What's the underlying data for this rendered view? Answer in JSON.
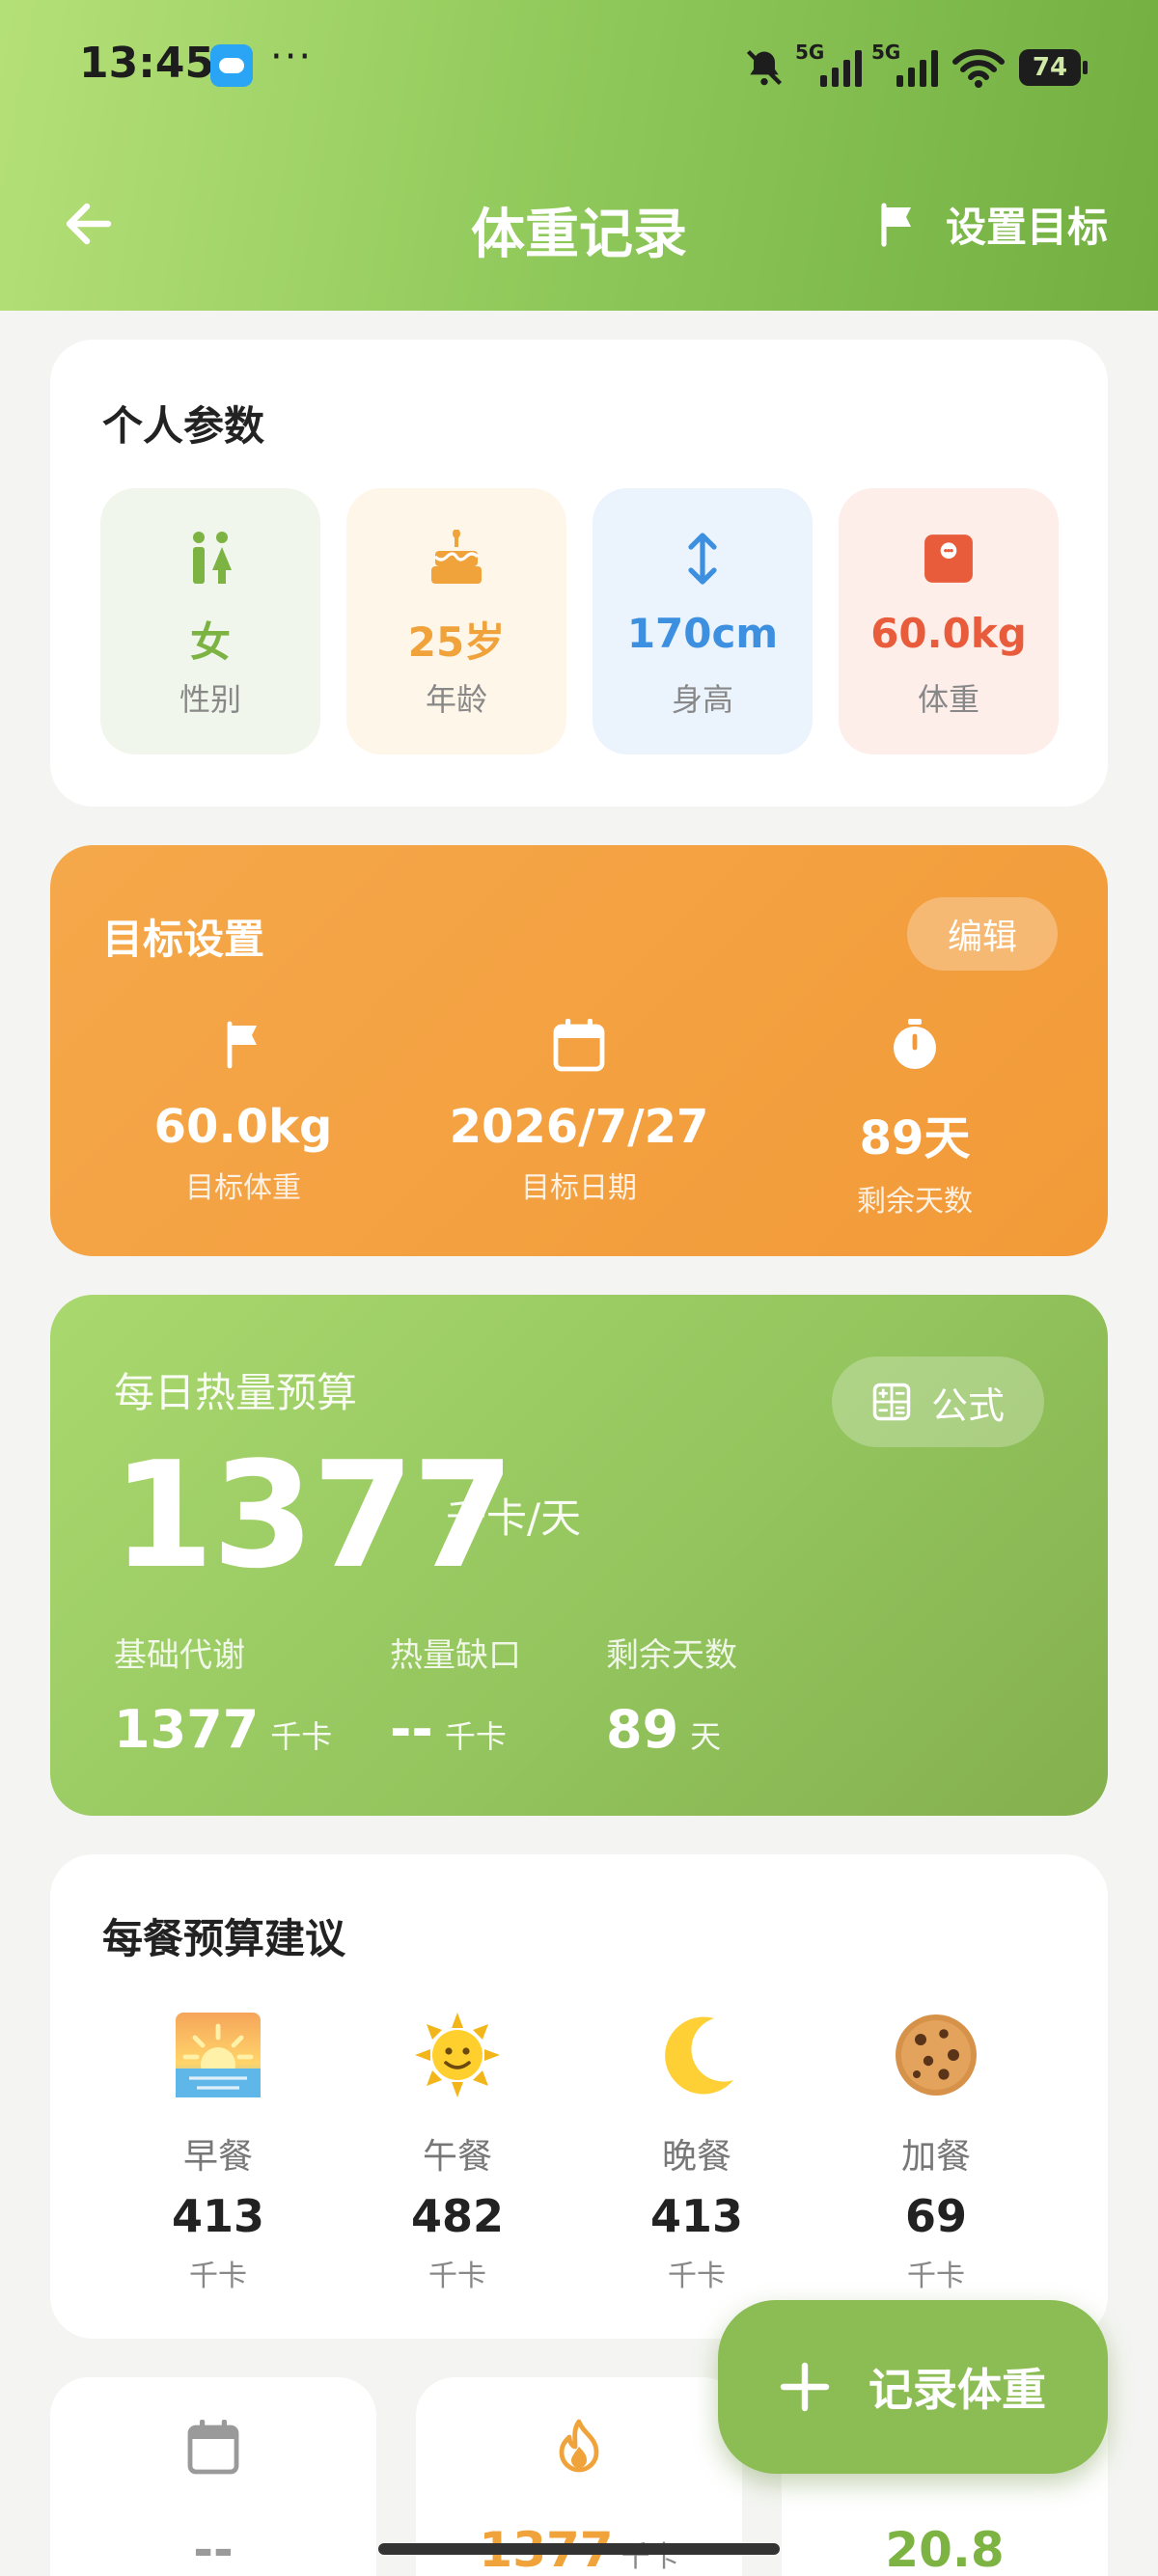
{
  "status": {
    "time": "13:45",
    "dots": "···",
    "sig1": "5G",
    "sig2": "5G",
    "battery": "74"
  },
  "nav": {
    "title": "体重记录",
    "goal_label": "设置目标"
  },
  "params": {
    "title": "个人参数",
    "items": [
      {
        "value": "女",
        "label": "性别",
        "icon": "gender-icon",
        "color": "#7cb342",
        "bg": "#f1f6ec"
      },
      {
        "value": "25岁",
        "label": "年龄",
        "icon": "cake-icon",
        "color": "#f0a33a",
        "bg": "#fff6ea"
      },
      {
        "value": "170cm",
        "label": "身高",
        "icon": "height-arrow-icon",
        "color": "#3d8fe0",
        "bg": "#ebf3fd"
      },
      {
        "value": "60.0kg",
        "label": "体重",
        "icon": "scale-icon",
        "color": "#e85c3c",
        "bg": "#fdeeea"
      }
    ]
  },
  "target": {
    "title": "目标设置",
    "edit_label": "编辑",
    "items": [
      {
        "value": "60.0kg",
        "label": "目标体重",
        "icon": "flag-icon"
      },
      {
        "value": "2026/7/27",
        "label": "目标日期",
        "icon": "calendar-icon"
      },
      {
        "value": "89天",
        "label": "剩余天数",
        "icon": "stopwatch-icon"
      }
    ]
  },
  "budget": {
    "label": "每日热量预算",
    "formula_label": "公式",
    "value": "1377",
    "unit": "千卡/天",
    "stats": [
      {
        "label": "基础代谢",
        "value": "1377",
        "unit": "千卡"
      },
      {
        "label": "热量缺口",
        "value": "--",
        "unit": "千卡"
      },
      {
        "label": "剩余天数",
        "value": "89",
        "unit": "天"
      }
    ]
  },
  "meals": {
    "title": "每餐预算建议",
    "items": [
      {
        "name": "早餐",
        "kcal": "413",
        "unit": "千卡",
        "icon": "sunrise-icon"
      },
      {
        "name": "午餐",
        "kcal": "482",
        "unit": "千卡",
        "icon": "sun-icon"
      },
      {
        "name": "晚餐",
        "kcal": "413",
        "unit": "千卡",
        "icon": "moon-icon"
      },
      {
        "name": "加餐",
        "kcal": "69",
        "unit": "千卡",
        "icon": "cookie-icon"
      }
    ]
  },
  "mini": [
    {
      "value": "--",
      "unit": "",
      "color": "#9a9a9a",
      "icon": "calendar-icon"
    },
    {
      "value": "1377",
      "unit": "千卡",
      "color": "#f0a33a",
      "icon": "flame-icon"
    },
    {
      "value": "20.8",
      "unit": "",
      "color": "#7cb342",
      "icon": "bmi-icon"
    }
  ],
  "fab": {
    "label": "记录体重"
  },
  "colors": {
    "header_green": "#8fc85a",
    "orange": "#f29a38",
    "accent_green": "#8cbd55"
  }
}
